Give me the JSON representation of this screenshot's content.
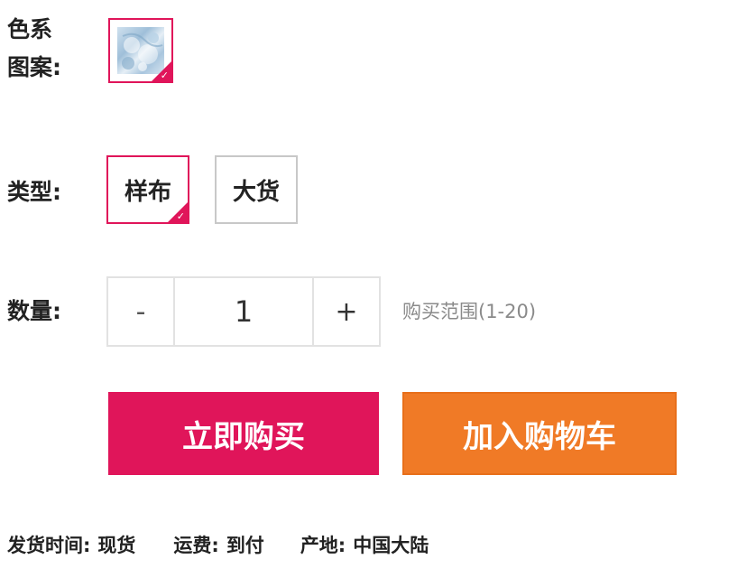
{
  "color_section": {
    "label_line1": "色系",
    "label_line2": "图案:",
    "swatch_icon": "floral-pattern-thumbnail",
    "selected": true
  },
  "type_section": {
    "label": "类型:",
    "options": [
      {
        "label": "样布",
        "selected": true
      },
      {
        "label": "大货",
        "selected": false
      }
    ]
  },
  "quantity_section": {
    "label": "数量:",
    "minus_label": "-",
    "value": "1",
    "plus_label": "+",
    "range_text": "购买范围(1-20)"
  },
  "actions": {
    "buy_now": "立即购买",
    "add_to_cart": "加入购物车"
  },
  "shipping": {
    "ship_time_label": "发货时间:",
    "ship_time_value": "现货",
    "freight_label": "运费:",
    "freight_value": "到付",
    "origin_label": "产地:",
    "origin_value": "中国大陆"
  },
  "colors": {
    "accent_pink": "#e0155a",
    "accent_orange": "#f07a26",
    "border_gray": "#c8c8c8",
    "muted_text": "#8a8a8a"
  }
}
